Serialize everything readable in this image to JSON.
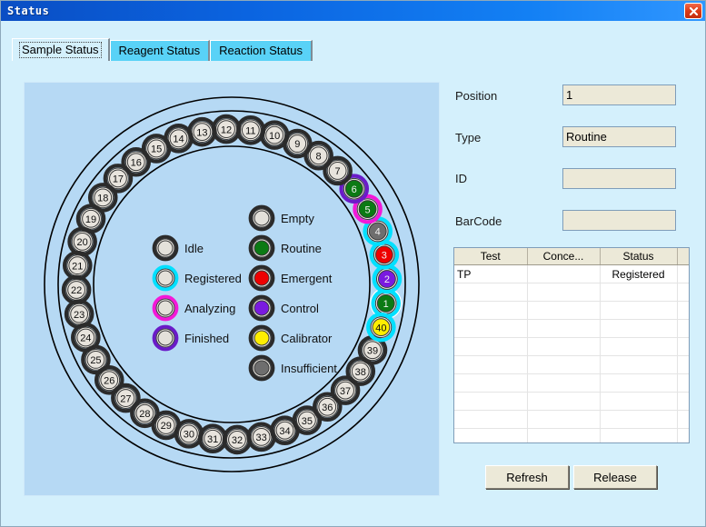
{
  "window": {
    "title": "Status",
    "close_icon": "close-icon",
    "bg_color": "#d4f0fc",
    "titlebar_color": "#0b64e0"
  },
  "tabs": [
    {
      "label": "Sample Status",
      "active": true
    },
    {
      "label": "Reagent Status",
      "active": false
    },
    {
      "label": "Reaction Status",
      "active": false
    }
  ],
  "carousel": {
    "total_positions": 40,
    "selected_position": 1,
    "samples": [
      {
        "pos": 1,
        "fill": "#0b7a14",
        "ring": "#00e0ff",
        "selected": true,
        "state": "Registered",
        "type": "Routine"
      },
      {
        "pos": 2,
        "fill": "#7a1ae0",
        "ring": "#00e0ff",
        "selected": false,
        "state": "Registered",
        "type": "Control"
      },
      {
        "pos": 3,
        "fill": "#ee0000",
        "ring": "#00e0ff",
        "selected": false,
        "state": "Registered",
        "type": "Emergent"
      },
      {
        "pos": 4,
        "fill": "#6e6e6e",
        "ring": "#00e0ff",
        "selected": false,
        "state": "Registered",
        "type": "Insufficient"
      },
      {
        "pos": 5,
        "fill": "#0b7a14",
        "ring": "#f318d8",
        "selected": false,
        "state": "Analyzing",
        "type": "Routine"
      },
      {
        "pos": 6,
        "fill": "#0b7a14",
        "ring": "#6a1bc8",
        "selected": false,
        "state": "Finished",
        "type": "Routine"
      },
      {
        "pos": 7,
        "fill": "#e8e4dd",
        "ring": "#2b2b2b",
        "selected": false,
        "state": "Idle",
        "type": "Empty"
      },
      {
        "pos": 8,
        "fill": "#e8e4dd",
        "ring": "#2b2b2b",
        "selected": false,
        "state": "Idle",
        "type": "Empty"
      },
      {
        "pos": 9,
        "fill": "#e8e4dd",
        "ring": "#2b2b2b",
        "selected": false,
        "state": "Idle",
        "type": "Empty"
      },
      {
        "pos": 10,
        "fill": "#e8e4dd",
        "ring": "#2b2b2b",
        "selected": false,
        "state": "Idle",
        "type": "Empty"
      },
      {
        "pos": 11,
        "fill": "#e8e4dd",
        "ring": "#2b2b2b",
        "selected": false,
        "state": "Idle",
        "type": "Empty"
      },
      {
        "pos": 12,
        "fill": "#e8e4dd",
        "ring": "#2b2b2b",
        "selected": false,
        "state": "Idle",
        "type": "Empty"
      },
      {
        "pos": 13,
        "fill": "#e8e4dd",
        "ring": "#2b2b2b",
        "selected": false,
        "state": "Idle",
        "type": "Empty"
      },
      {
        "pos": 14,
        "fill": "#e8e4dd",
        "ring": "#2b2b2b",
        "selected": false,
        "state": "Idle",
        "type": "Empty"
      },
      {
        "pos": 15,
        "fill": "#e8e4dd",
        "ring": "#2b2b2b",
        "selected": false,
        "state": "Idle",
        "type": "Empty"
      },
      {
        "pos": 16,
        "fill": "#e8e4dd",
        "ring": "#2b2b2b",
        "selected": false,
        "state": "Idle",
        "type": "Empty"
      },
      {
        "pos": 17,
        "fill": "#e8e4dd",
        "ring": "#2b2b2b",
        "selected": false,
        "state": "Idle",
        "type": "Empty"
      },
      {
        "pos": 18,
        "fill": "#e8e4dd",
        "ring": "#2b2b2b",
        "selected": false,
        "state": "Idle",
        "type": "Empty"
      },
      {
        "pos": 19,
        "fill": "#e8e4dd",
        "ring": "#2b2b2b",
        "selected": false,
        "state": "Idle",
        "type": "Empty"
      },
      {
        "pos": 20,
        "fill": "#e8e4dd",
        "ring": "#2b2b2b",
        "selected": false,
        "state": "Idle",
        "type": "Empty"
      },
      {
        "pos": 21,
        "fill": "#e8e4dd",
        "ring": "#2b2b2b",
        "selected": false,
        "state": "Idle",
        "type": "Empty"
      },
      {
        "pos": 22,
        "fill": "#e8e4dd",
        "ring": "#2b2b2b",
        "selected": false,
        "state": "Idle",
        "type": "Empty"
      },
      {
        "pos": 23,
        "fill": "#e8e4dd",
        "ring": "#2b2b2b",
        "selected": false,
        "state": "Idle",
        "type": "Empty"
      },
      {
        "pos": 24,
        "fill": "#e8e4dd",
        "ring": "#2b2b2b",
        "selected": false,
        "state": "Idle",
        "type": "Empty"
      },
      {
        "pos": 25,
        "fill": "#e8e4dd",
        "ring": "#2b2b2b",
        "selected": false,
        "state": "Idle",
        "type": "Empty"
      },
      {
        "pos": 26,
        "fill": "#e8e4dd",
        "ring": "#2b2b2b",
        "selected": false,
        "state": "Idle",
        "type": "Empty"
      },
      {
        "pos": 27,
        "fill": "#e8e4dd",
        "ring": "#2b2b2b",
        "selected": false,
        "state": "Idle",
        "type": "Empty"
      },
      {
        "pos": 28,
        "fill": "#e8e4dd",
        "ring": "#2b2b2b",
        "selected": false,
        "state": "Idle",
        "type": "Empty"
      },
      {
        "pos": 29,
        "fill": "#e8e4dd",
        "ring": "#2b2b2b",
        "selected": false,
        "state": "Idle",
        "type": "Empty"
      },
      {
        "pos": 30,
        "fill": "#e8e4dd",
        "ring": "#2b2b2b",
        "selected": false,
        "state": "Idle",
        "type": "Empty"
      },
      {
        "pos": 31,
        "fill": "#e8e4dd",
        "ring": "#2b2b2b",
        "selected": false,
        "state": "Idle",
        "type": "Empty"
      },
      {
        "pos": 32,
        "fill": "#e8e4dd",
        "ring": "#2b2b2b",
        "selected": false,
        "state": "Idle",
        "type": "Empty"
      },
      {
        "pos": 33,
        "fill": "#e8e4dd",
        "ring": "#2b2b2b",
        "selected": false,
        "state": "Idle",
        "type": "Empty"
      },
      {
        "pos": 34,
        "fill": "#e8e4dd",
        "ring": "#2b2b2b",
        "selected": false,
        "state": "Idle",
        "type": "Empty"
      },
      {
        "pos": 35,
        "fill": "#e8e4dd",
        "ring": "#2b2b2b",
        "selected": false,
        "state": "Idle",
        "type": "Empty"
      },
      {
        "pos": 36,
        "fill": "#e8e4dd",
        "ring": "#2b2b2b",
        "selected": false,
        "state": "Idle",
        "type": "Empty"
      },
      {
        "pos": 37,
        "fill": "#e8e4dd",
        "ring": "#2b2b2b",
        "selected": false,
        "state": "Idle",
        "type": "Empty"
      },
      {
        "pos": 38,
        "fill": "#e8e4dd",
        "ring": "#2b2b2b",
        "selected": false,
        "state": "Idle",
        "type": "Empty"
      },
      {
        "pos": 39,
        "fill": "#e8e4dd",
        "ring": "#2b2b2b",
        "selected": false,
        "state": "Idle",
        "type": "Empty"
      },
      {
        "pos": 40,
        "fill": "#ffee00",
        "ring": "#00e0ff",
        "selected": false,
        "state": "Registered",
        "type": "Calibrator"
      }
    ],
    "legend_status": [
      {
        "label": "Idle",
        "ring": "#2b2b2b",
        "fill": "#e4e1da"
      },
      {
        "label": "Registered",
        "ring": "#00e0ff",
        "fill": "#e4e1da"
      },
      {
        "label": "Analyzing",
        "ring": "#f318d8",
        "fill": "#e4e1da"
      },
      {
        "label": "Finished",
        "ring": "#6a1bc8",
        "fill": "#e4e1da"
      }
    ],
    "legend_type": [
      {
        "label": "Empty",
        "ring": "#2b2b2b",
        "fill": "#e4e1da"
      },
      {
        "label": "Routine",
        "ring": "#2b2b2b",
        "fill": "#0b7a14"
      },
      {
        "label": "Emergent",
        "ring": "#2b2b2b",
        "fill": "#ee0000"
      },
      {
        "label": "Control",
        "ring": "#2b2b2b",
        "fill": "#7a1ae0"
      },
      {
        "label": "Calibrator",
        "ring": "#2b2b2b",
        "fill": "#ffee00"
      },
      {
        "label": "Insufficient",
        "ring": "#2b2b2b",
        "fill": "#6e6e6e"
      }
    ]
  },
  "details": {
    "position": {
      "label": "Position",
      "value": "1"
    },
    "type": {
      "label": "Type",
      "value": "Routine"
    },
    "id": {
      "label": "ID",
      "value": ""
    },
    "barcode": {
      "label": "BarCode",
      "value": ""
    }
  },
  "test_table": {
    "columns": [
      "Test",
      "Conce...",
      "Status",
      ""
    ],
    "rows": [
      {
        "test": "TP",
        "conc": "",
        "status": "Registered"
      },
      {
        "test": "",
        "conc": "",
        "status": ""
      },
      {
        "test": "",
        "conc": "",
        "status": ""
      },
      {
        "test": "",
        "conc": "",
        "status": ""
      },
      {
        "test": "",
        "conc": "",
        "status": ""
      },
      {
        "test": "",
        "conc": "",
        "status": ""
      },
      {
        "test": "",
        "conc": "",
        "status": ""
      },
      {
        "test": "",
        "conc": "",
        "status": ""
      },
      {
        "test": "",
        "conc": "",
        "status": ""
      },
      {
        "test": "",
        "conc": "",
        "status": ""
      },
      {
        "test": "",
        "conc": "",
        "status": ""
      }
    ]
  },
  "buttons": {
    "refresh": "Refresh",
    "release": "Release"
  }
}
